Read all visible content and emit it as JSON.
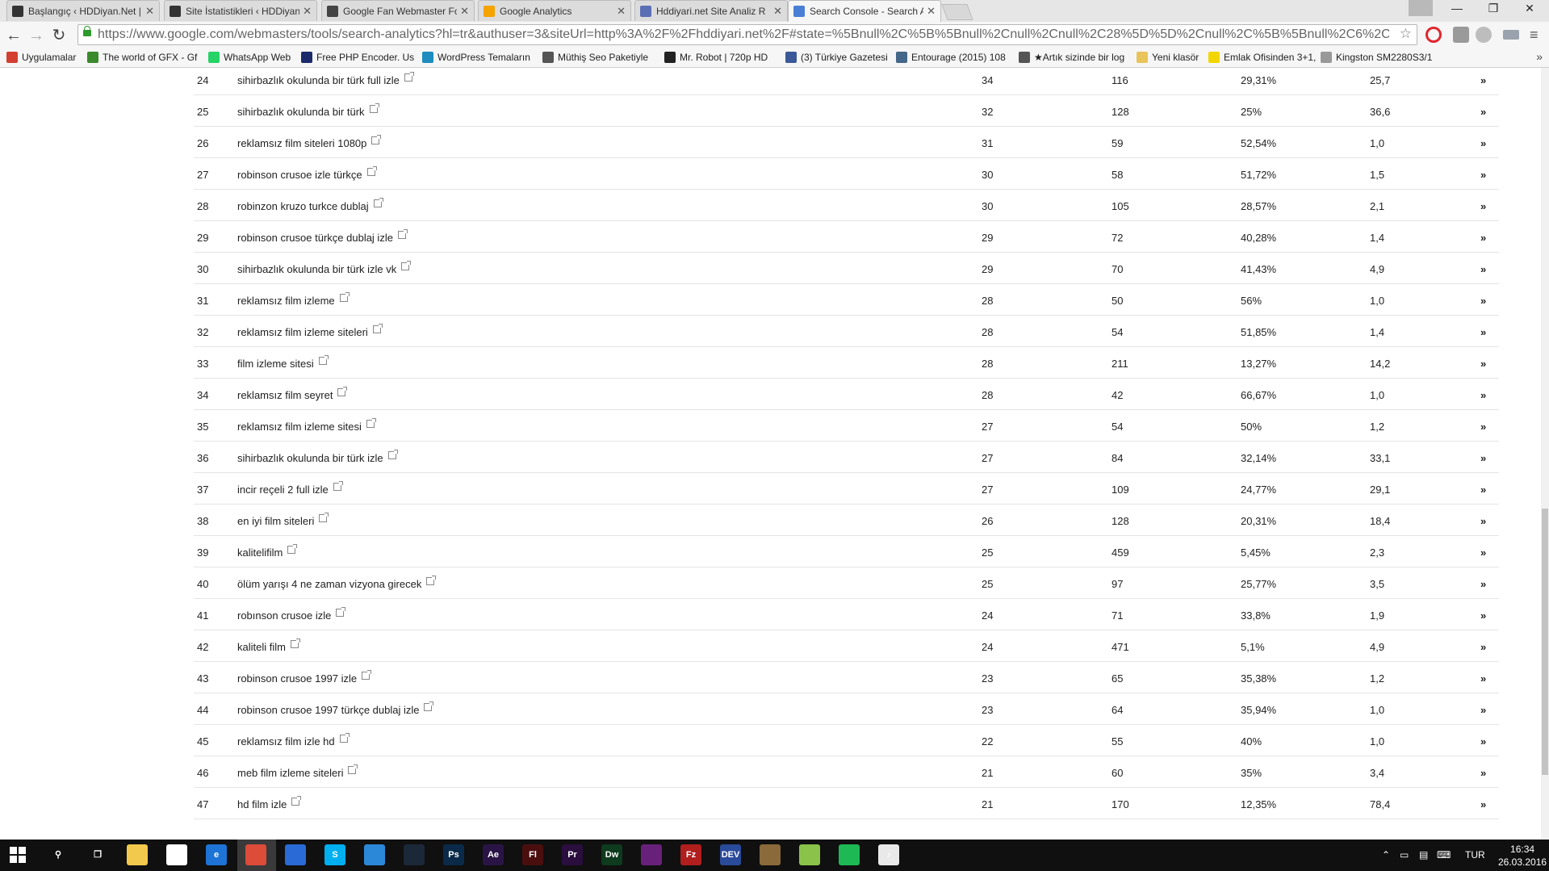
{
  "browser": {
    "tabs": [
      {
        "label": "Başlangıç ‹ HDDiyan.Net |",
        "icon_color": "#333333",
        "active": false
      },
      {
        "label": "Site İstatistikleri ‹ HDDiyan",
        "icon_color": "#333333",
        "active": false
      },
      {
        "label": "Google Fan Webmaster Fo",
        "icon_color": "#444444",
        "active": false
      },
      {
        "label": "Google Analytics",
        "icon_color": "#f4a300",
        "active": false
      },
      {
        "label": "Hddiyari.net Site Analiz R",
        "icon_color": "#5b6fb5",
        "active": false
      },
      {
        "label": "Search Console - Search A",
        "icon_color": "#4a7fd6",
        "active": true
      }
    ],
    "url": "https://www.google.com/webmasters/tools/search-analytics?hl=tr&authuser=3&siteUrl=http%3A%2F%2Fhddiyari.net%2F#state=%5Bnull%2C%5B%5Bnull%2Cnull%2Cnull%2C28%5D%5D%2Cnull%2C%5B%5Bnull%2C6%2C%5B%",
    "bookmarks": [
      {
        "label": "Uygulamalar",
        "icon_color": "#d23f31"
      },
      {
        "label": "The world of GFX - Gf",
        "icon_color": "#3b8a2b"
      },
      {
        "label": "WhatsApp Web",
        "icon_color": "#25d366"
      },
      {
        "label": "Free PHP Encoder. Us",
        "icon_color": "#1a2a6a"
      },
      {
        "label": "WordPress Temaların",
        "icon_color": "#1e8cbe"
      },
      {
        "label": "Müthiş Seo Paketiyle",
        "icon_color": "#555555"
      },
      {
        "label": "Mr. Robot | 720p HD",
        "icon_color": "#222222"
      },
      {
        "label": "(3) Türkiye Gazetesi",
        "icon_color": "#3b5998"
      },
      {
        "label": "Entourage (2015) 108",
        "icon_color": "#446688"
      },
      {
        "label": "★Artık sizinde bir log",
        "icon_color": "#555555"
      },
      {
        "label": "Yeni klasör",
        "icon_color": "#e8c45a"
      },
      {
        "label": "Emlak Ofisinden 3+1,",
        "icon_color": "#f2d600"
      },
      {
        "label": "Kingston SM2280S3/1",
        "icon_color": "#999999"
      }
    ],
    "window_controls": {
      "minimize": "—",
      "maximize": "❐",
      "close": "✕"
    }
  },
  "table": {
    "rows": [
      {
        "idx": "24",
        "query": "sihirbazlık okulunda bir türk full izle",
        "clicks": "34",
        "impressions": "116",
        "ctr": "29,31%",
        "position": "25,7"
      },
      {
        "idx": "25",
        "query": "sihirbazlık okulunda bir türk",
        "clicks": "32",
        "impressions": "128",
        "ctr": "25%",
        "position": "36,6"
      },
      {
        "idx": "26",
        "query": "reklamsız film siteleri 1080p",
        "clicks": "31",
        "impressions": "59",
        "ctr": "52,54%",
        "position": "1,0"
      },
      {
        "idx": "27",
        "query": "robinson crusoe izle türkçe",
        "clicks": "30",
        "impressions": "58",
        "ctr": "51,72%",
        "position": "1,5"
      },
      {
        "idx": "28",
        "query": "robinzon kruzo turkce dublaj",
        "clicks": "30",
        "impressions": "105",
        "ctr": "28,57%",
        "position": "2,1"
      },
      {
        "idx": "29",
        "query": "robinson crusoe türkçe dublaj izle",
        "clicks": "29",
        "impressions": "72",
        "ctr": "40,28%",
        "position": "1,4"
      },
      {
        "idx": "30",
        "query": "sihirbazlık okulunda bir türk izle vk",
        "clicks": "29",
        "impressions": "70",
        "ctr": "41,43%",
        "position": "4,9"
      },
      {
        "idx": "31",
        "query": "reklamsız film izleme",
        "clicks": "28",
        "impressions": "50",
        "ctr": "56%",
        "position": "1,0"
      },
      {
        "idx": "32",
        "query": "reklamsız film izleme siteleri",
        "clicks": "28",
        "impressions": "54",
        "ctr": "51,85%",
        "position": "1,4"
      },
      {
        "idx": "33",
        "query": "film izleme sitesi",
        "clicks": "28",
        "impressions": "211",
        "ctr": "13,27%",
        "position": "14,2"
      },
      {
        "idx": "34",
        "query": "reklamsız film seyret",
        "clicks": "28",
        "impressions": "42",
        "ctr": "66,67%",
        "position": "1,0"
      },
      {
        "idx": "35",
        "query": "reklamsız film izleme sitesi",
        "clicks": "27",
        "impressions": "54",
        "ctr": "50%",
        "position": "1,2"
      },
      {
        "idx": "36",
        "query": "sihirbazlık okulunda bir türk izle",
        "clicks": "27",
        "impressions": "84",
        "ctr": "32,14%",
        "position": "33,1"
      },
      {
        "idx": "37",
        "query": "incir reçeli 2 full izle",
        "clicks": "27",
        "impressions": "109",
        "ctr": "24,77%",
        "position": "29,1"
      },
      {
        "idx": "38",
        "query": "en iyi film siteleri",
        "clicks": "26",
        "impressions": "128",
        "ctr": "20,31%",
        "position": "18,4"
      },
      {
        "idx": "39",
        "query": "kalitelifilm",
        "clicks": "25",
        "impressions": "459",
        "ctr": "5,45%",
        "position": "2,3"
      },
      {
        "idx": "40",
        "query": "ölüm yarışı 4 ne zaman vizyona girecek",
        "clicks": "25",
        "impressions": "97",
        "ctr": "25,77%",
        "position": "3,5"
      },
      {
        "idx": "41",
        "query": "robınson crusoe izle",
        "clicks": "24",
        "impressions": "71",
        "ctr": "33,8%",
        "position": "1,9"
      },
      {
        "idx": "42",
        "query": "kaliteli film",
        "clicks": "24",
        "impressions": "471",
        "ctr": "5,1%",
        "position": "4,9"
      },
      {
        "idx": "43",
        "query": "robinson crusoe 1997 izle",
        "clicks": "23",
        "impressions": "65",
        "ctr": "35,38%",
        "position": "1,2"
      },
      {
        "idx": "44",
        "query": "robinson crusoe 1997 türkçe dublaj izle",
        "clicks": "23",
        "impressions": "64",
        "ctr": "35,94%",
        "position": "1,0"
      },
      {
        "idx": "45",
        "query": "reklamsız film izle hd",
        "clicks": "22",
        "impressions": "55",
        "ctr": "40%",
        "position": "1,0"
      },
      {
        "idx": "46",
        "query": "meb film izleme siteleri",
        "clicks": "21",
        "impressions": "60",
        "ctr": "35%",
        "position": "3,4"
      },
      {
        "idx": "47",
        "query": "hd film izle",
        "clicks": "21",
        "impressions": "170",
        "ctr": "12,35%",
        "position": "78,4"
      }
    ],
    "row_action_glyph": "»"
  },
  "taskbar": {
    "apps": [
      {
        "name": "search-icon",
        "glyph": "⚲",
        "color": "#101010"
      },
      {
        "name": "task-view-icon",
        "glyph": "❐",
        "color": "#101010"
      },
      {
        "name": "file-explorer-icon",
        "glyph": "",
        "color": "#f2c94c"
      },
      {
        "name": "store-icon",
        "glyph": "",
        "color": "#ffffff"
      },
      {
        "name": "edge-icon",
        "glyph": "e",
        "color": "#1e73d6"
      },
      {
        "name": "chrome-icon",
        "glyph": "",
        "color": "#dd4b39"
      },
      {
        "name": "mail-icon",
        "glyph": "",
        "color": "#2a6ad6"
      },
      {
        "name": "skype-icon",
        "glyph": "S",
        "color": "#00aff0"
      },
      {
        "name": "notes-icon",
        "glyph": "",
        "color": "#2b88d8"
      },
      {
        "name": "steam-icon",
        "glyph": "",
        "color": "#1b2838"
      },
      {
        "name": "photoshop-icon",
        "glyph": "Ps",
        "color": "#0b2a4a"
      },
      {
        "name": "after-effects-icon",
        "glyph": "Ae",
        "color": "#2a1446"
      },
      {
        "name": "flash-icon",
        "glyph": "Fl",
        "color": "#4a0e0e"
      },
      {
        "name": "premiere-icon",
        "glyph": "Pr",
        "color": "#2a0e3e"
      },
      {
        "name": "dreamweaver-icon",
        "glyph": "Dw",
        "color": "#0e3a1e"
      },
      {
        "name": "visual-studio-icon",
        "glyph": "",
        "color": "#68217a"
      },
      {
        "name": "filezilla-icon",
        "glyph": "Fz",
        "color": "#b01e1e"
      },
      {
        "name": "dev-icon",
        "glyph": "DEV",
        "color": "#2a4a9a"
      },
      {
        "name": "app-icon",
        "glyph": "",
        "color": "#8a6a3a"
      },
      {
        "name": "notepad-icon",
        "glyph": "",
        "color": "#8ac24a"
      },
      {
        "name": "spotify-icon",
        "glyph": "",
        "color": "#1db954"
      },
      {
        "name": "itunes-icon",
        "glyph": "♪",
        "color": "#e9e9e9"
      }
    ],
    "tray_language": "TUR",
    "time": "16:34",
    "date": "26.03.2016"
  }
}
